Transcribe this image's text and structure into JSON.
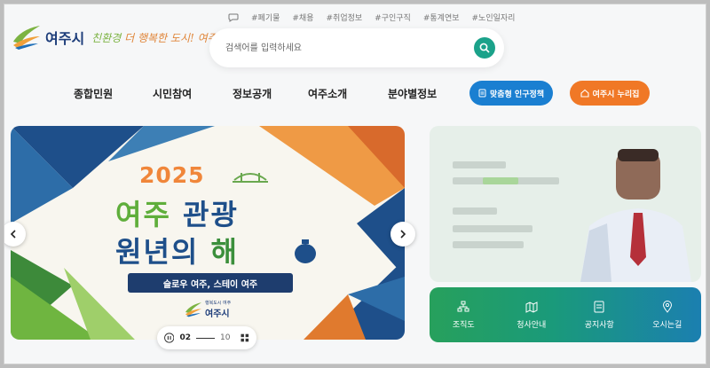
{
  "header": {
    "tags": [
      "#폐기물",
      "#채용",
      "#취업정보",
      "#구인구직",
      "#통계연보",
      "#노인일자리"
    ],
    "logo_name": "여주시",
    "slogan_part1": "친환경",
    "slogan_part2": " 더 행복한 도시! 여주",
    "search_placeholder": "검색어를 입력하세요"
  },
  "nav": {
    "items": [
      "종합민원",
      "시민참여",
      "정보공개",
      "여주소개",
      "분야별정보"
    ],
    "policy_button": "맞춤형 인구정책",
    "nurijip_button": "여주시 누리집"
  },
  "banner": {
    "year": "2025",
    "line1_a": "여주",
    "line1_b": " 관광",
    "line2_a": "원년의 ",
    "line2_b": "해",
    "subtitle": "슬로우 여주, 스테이 여주",
    "logo_text": "여주시",
    "logo_small": "행복도시 여주",
    "current": "02",
    "total": "10"
  },
  "quick_menu": [
    {
      "label": "조직도",
      "icon": "org-chart-icon"
    },
    {
      "label": "청사안내",
      "icon": "building-map-icon"
    },
    {
      "label": "공지사항",
      "icon": "notice-icon"
    },
    {
      "label": "오시는길",
      "icon": "location-pin-icon"
    }
  ],
  "colors": {
    "brand_blue": "#1d3d7a",
    "search_green": "#1ba28a",
    "policy_blue": "#1a7fd1",
    "nurijip_orange": "#f07826"
  }
}
